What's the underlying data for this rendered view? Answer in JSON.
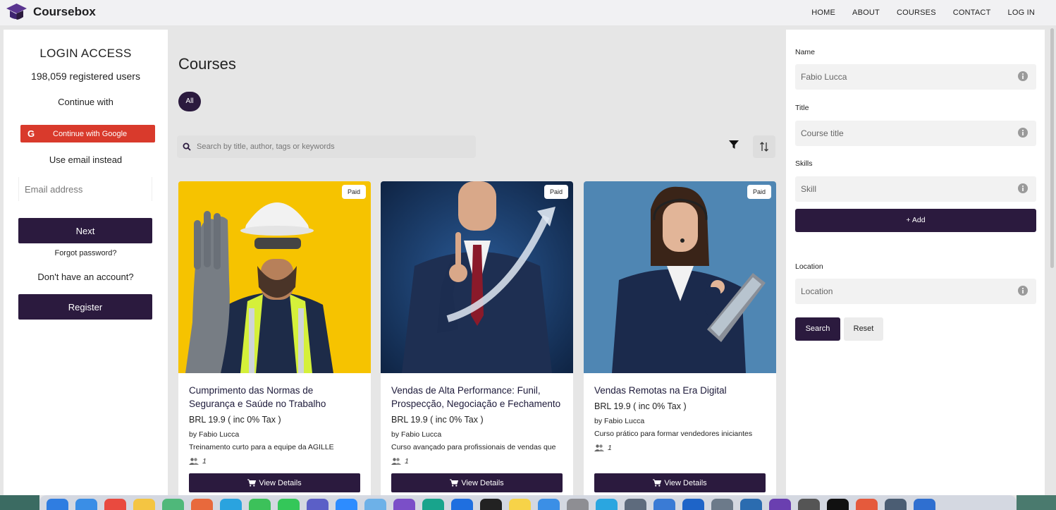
{
  "brand": {
    "name": "Coursebox",
    "colors": {
      "primary": "#2b1a3e",
      "google": "#d93a2c"
    }
  },
  "nav": [
    "HOME",
    "ABOUT",
    "COURSES",
    "CONTACT",
    "LOG IN"
  ],
  "login": {
    "title": "LOGIN ACCESS",
    "users": "198,059 registered users",
    "continue_with": "Continue with",
    "google_label": "Continue with Google",
    "google_icon": "G",
    "use_email": "Use email instead",
    "email_placeholder": "Email address",
    "next": "Next",
    "forgot": "Forgot password?",
    "no_account": "Don't have an account?",
    "register": "Register"
  },
  "main": {
    "title": "Courses",
    "filter_all": "All",
    "search_placeholder": "Search by title, author, tags or keywords",
    "cards": [
      {
        "badge": "Paid",
        "title": "Cumprimento das Normas de Segurança e Saúde no Trabalho",
        "price": "BRL 19.9 ( inc 0% Tax )",
        "author": "by Fabio Lucca",
        "description": "Treinamento curto para a equipe da AGILLE",
        "users": "1",
        "button": "View Details"
      },
      {
        "badge": "Paid",
        "title": "Vendas de Alta Performance: Funil, Prospecção, Negociação e Fechamento",
        "price": "BRL 19.9 ( inc 0% Tax )",
        "author": "by Fabio Lucca",
        "description": "Curso avançado para profissionais de vendas que",
        "users": "1",
        "button": "View Details"
      },
      {
        "badge": "Paid",
        "title": "Vendas Remotas na Era Digital",
        "price": "BRL 19.9 ( inc 0% Tax )",
        "author": "by Fabio Lucca",
        "description": "Curso prático para formar vendedores iniciantes",
        "users": "1",
        "button": "View Details"
      }
    ]
  },
  "filters": {
    "name_label": "Name",
    "name_value": "Fabio Lucca",
    "title_label": "Title",
    "title_placeholder": "Course title",
    "skills_label": "Skills",
    "skill_placeholder": "Skill",
    "add": "+ Add",
    "location_label": "Location",
    "location_placeholder": "Location",
    "search": "Search",
    "reset": "Reset"
  }
}
